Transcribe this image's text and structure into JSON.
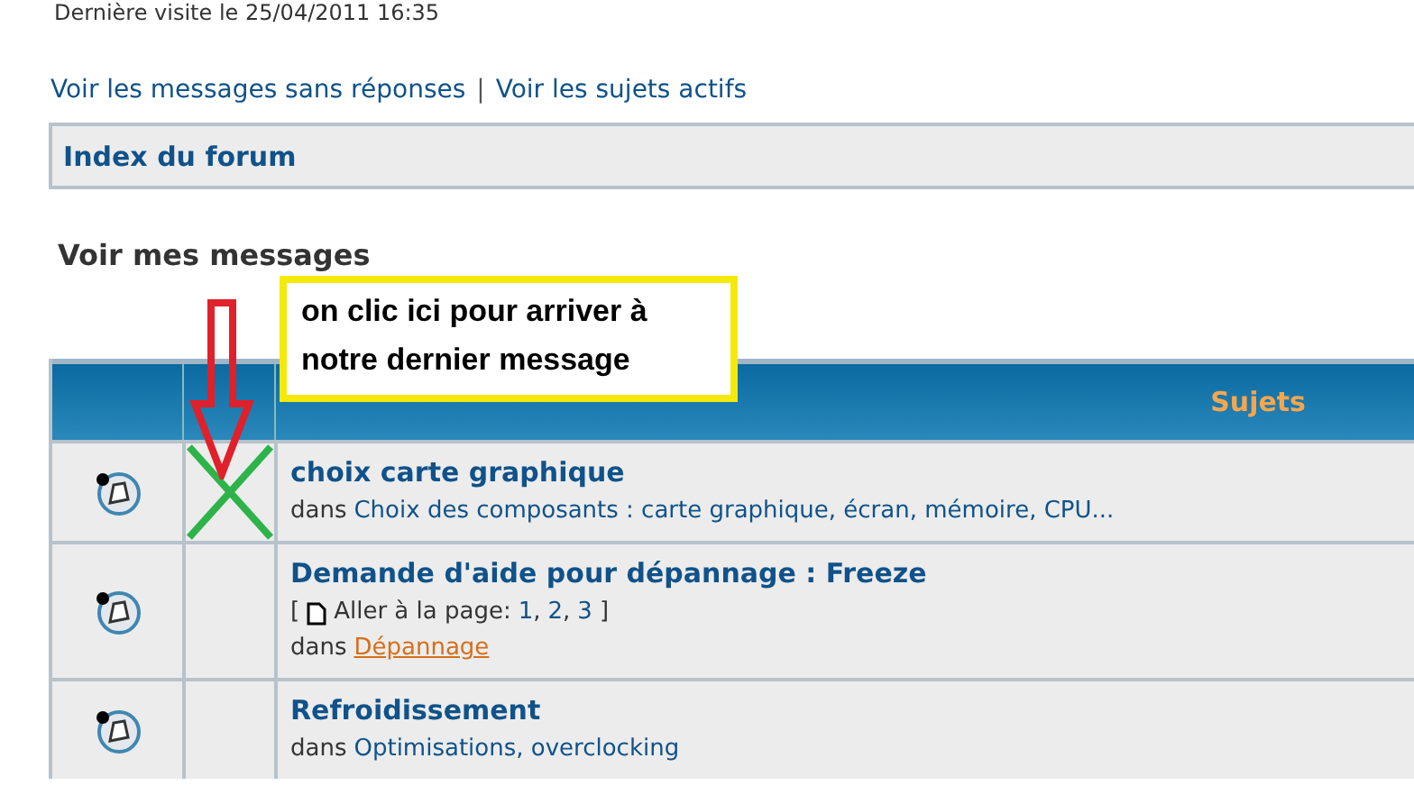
{
  "last_visit": "Dernière visite le 25/04/2011 16:35",
  "links": [
    "Voir les messages sans réponses",
    "Voir les sujets actifs"
  ],
  "separator": "|",
  "breadcrumb": "Index du forum",
  "heading": "Voir mes messages",
  "table": {
    "columns": [
      "Sujets"
    ],
    "rows": [
      {
        "title": "choix carte graphique",
        "crossed": true,
        "prefix": "dans",
        "category": "Choix des composants : carte graphique, écran, mémoire, CPU...",
        "category_visited": false
      },
      {
        "title": "Demande d'aide pour dépannage : Freeze",
        "crossed": false,
        "pages": {
          "open": "[",
          "label": "Aller à la page:",
          "numbers": [
            "1",
            "2",
            "3"
          ],
          "separator": ",",
          "close": "]"
        },
        "prefix": "dans",
        "category": "Dépannage",
        "category_visited": true
      },
      {
        "title": "Refroidissement",
        "crossed": false,
        "prefix": "dans",
        "category": "Optimisations, overclocking",
        "category_visited": false
      }
    ]
  },
  "annotation": {
    "text": "on clic ici pour arriver à notre dernier message"
  }
}
